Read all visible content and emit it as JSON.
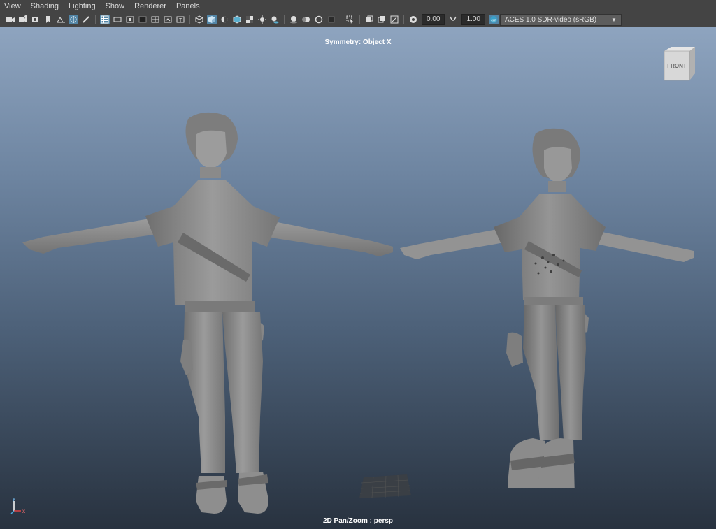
{
  "menu": [
    "View",
    "Shading",
    "Lighting",
    "Show",
    "Renderer",
    "Panels"
  ],
  "toolbar": {
    "exposure_value": "0.00",
    "gamma_value": "1.00",
    "color_space": "ACES 1.0 SDR-video (sRGB)"
  },
  "viewport": {
    "symmetry_label": "Symmetry: Object X",
    "status_label": "2D Pan/Zoom : persp",
    "viewcube_label": "FRONT",
    "axis_y": "y",
    "axis_x": "x"
  },
  "colors": {
    "bg_top": "#8ea4bf",
    "bg_bottom": "#28323f",
    "active_button": "#5285a6",
    "model": "#8a8a8a"
  }
}
